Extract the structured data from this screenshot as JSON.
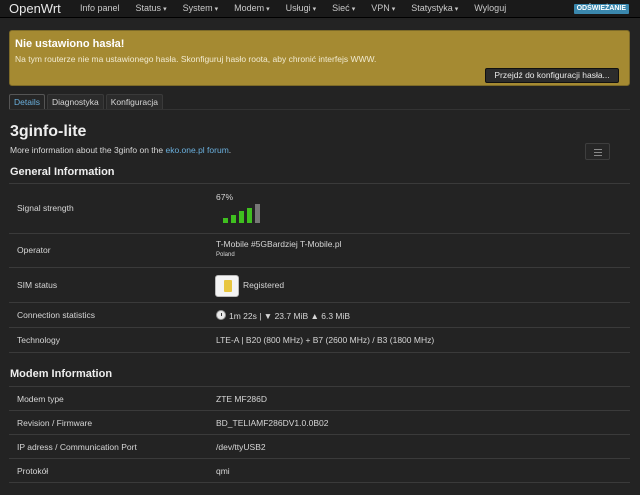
{
  "nav": {
    "brand": "OpenWrt",
    "items": [
      {
        "label": "Info panel",
        "has_caret": false
      },
      {
        "label": "Status",
        "has_caret": true
      },
      {
        "label": "System",
        "has_caret": true
      },
      {
        "label": "Modem",
        "has_caret": true
      },
      {
        "label": "Usługi",
        "has_caret": true
      },
      {
        "label": "Sieć",
        "has_caret": true
      },
      {
        "label": "VPN",
        "has_caret": true
      },
      {
        "label": "Statystyka",
        "has_caret": true
      },
      {
        "label": "Wyloguj",
        "has_caret": false
      }
    ],
    "refresh_badge": "ODŚWIEŻANIE"
  },
  "alert": {
    "title": "Nie ustawiono hasła!",
    "text": "Na tym routerze nie ma ustawionego hasła. Skonfiguruj hasło roota, aby chronić interfejs WWW.",
    "button": "Przejdź do konfiguracji hasła..."
  },
  "tabs": [
    {
      "label": "Details",
      "active": true
    },
    {
      "label": "Diagnostyka",
      "active": false
    },
    {
      "label": "Konfiguracja",
      "active": false
    }
  ],
  "page": {
    "title": "3ginfo-lite",
    "desc_prefix": "More information about the 3ginfo on the ",
    "desc_link": "eko.one.pl forum",
    "desc_suffix": "."
  },
  "general": {
    "title": "General Information",
    "signal": {
      "label": "Signal strength",
      "percent_text": "67%",
      "bars_total": 5,
      "bars_active": 4,
      "color_active": "#3fbf1f",
      "color_inactive": "#777777"
    },
    "operator": {
      "label": "Operator",
      "value": "T-Mobile #5GBardziej T-Mobile.pl",
      "sub": "Poland"
    },
    "sim": {
      "label": "SIM status",
      "value": "Registered",
      "icon": "sim-card-icon"
    },
    "connection": {
      "label": "Connection statistics",
      "value": "1m 22s | ▼ 23.7 MiB ▲ 6.3 MiB",
      "icon": "stopwatch-icon"
    },
    "technology": {
      "label": "Technology",
      "value": "LTE-A | B20 (800 MHz) + B7 (2600 MHz) / B3 (1800 MHz)"
    }
  },
  "modem": {
    "title": "Modem Information",
    "rows": [
      {
        "label": "Modem type",
        "value": "ZTE MF286D"
      },
      {
        "label": "Revision / Firmware",
        "value": "BD_TELIAMF286DV1.0.0B02"
      },
      {
        "label": "IP adress / Communication Port",
        "value": "/dev/ttyUSB2"
      },
      {
        "label": "Protokół",
        "value": "qmi"
      }
    ]
  }
}
